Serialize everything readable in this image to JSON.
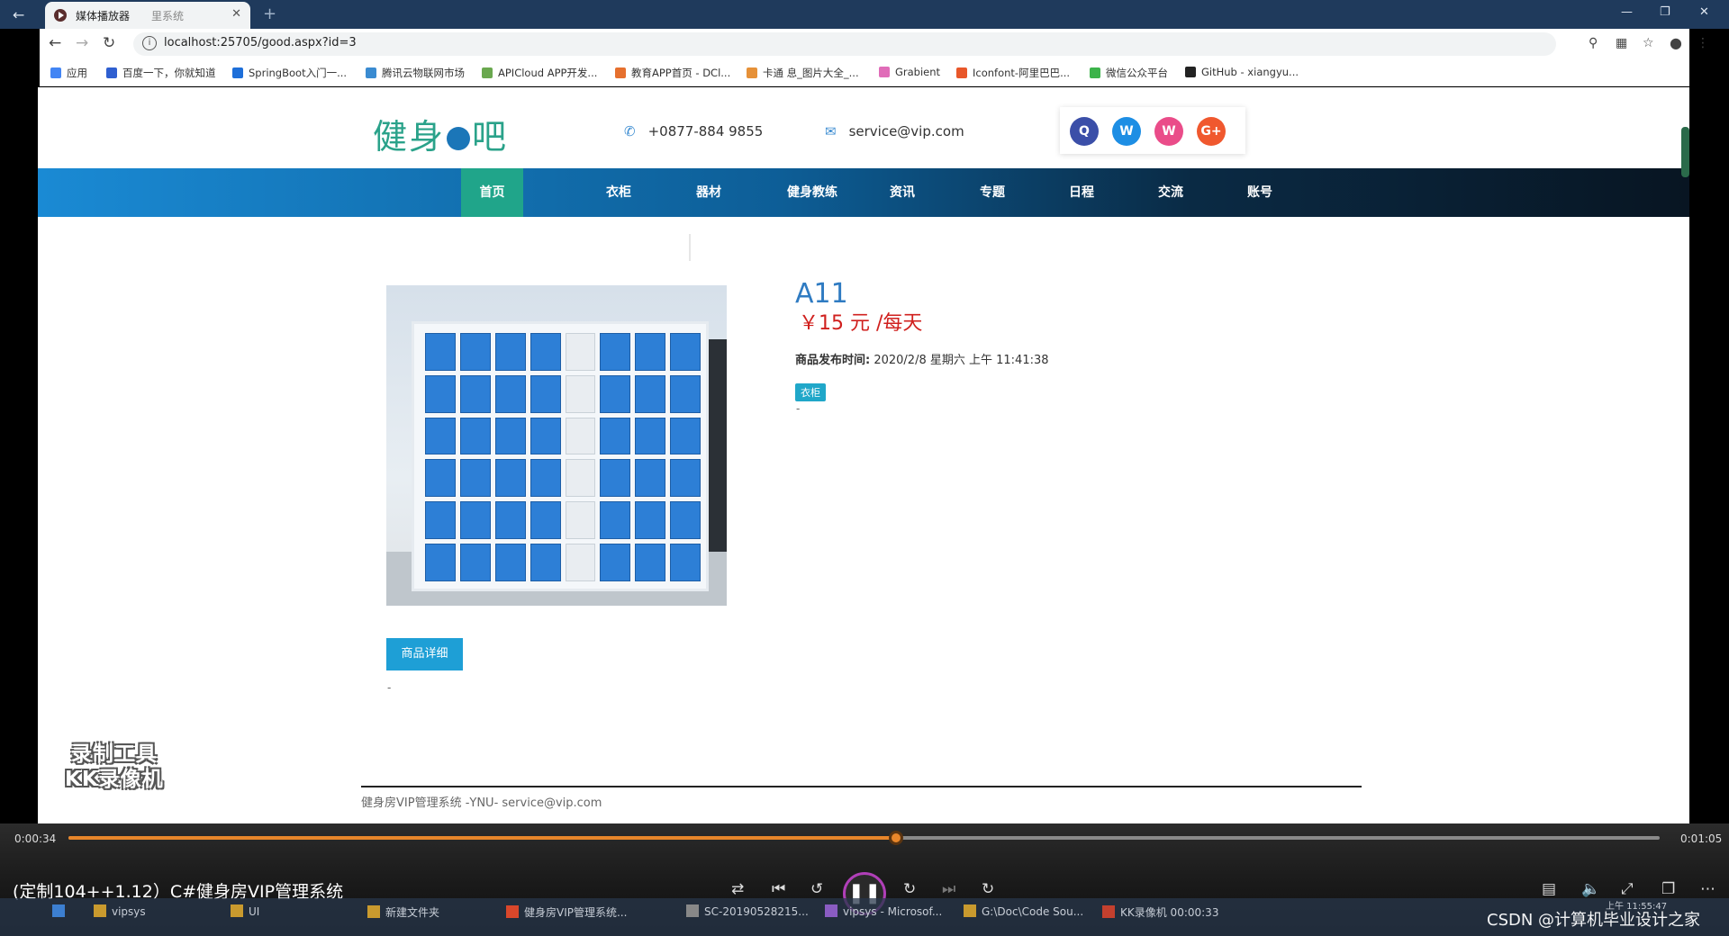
{
  "browser": {
    "tab_title": "媒体播放器",
    "tab_sub": "里系统",
    "url": "localhost:25705/good.aspx?id=3",
    "bookmarks": [
      {
        "label": "应用",
        "color": "#4285f4"
      },
      {
        "label": "百度一下，你就知道",
        "color": "#2f5fd0"
      },
      {
        "label": "SpringBoot入门一...",
        "color": "#1e6fd9"
      },
      {
        "label": "腾讯云物联网市场",
        "color": "#3a8bd1"
      },
      {
        "label": "APICloud APP开发...",
        "color": "#6aa84f"
      },
      {
        "label": "教育APP首页 - DCl...",
        "color": "#e6702e"
      },
      {
        "label": "卡通 息_图片大全_...",
        "color": "#e69138"
      },
      {
        "label": "Grabient",
        "color": "#e06cb8"
      },
      {
        "label": "Iconfont-阿里巴巴...",
        "color": "#e8572a"
      },
      {
        "label": "微信公众平台",
        "color": "#3cb34a"
      },
      {
        "label": "GitHub - xiangyu...",
        "color": "#222222"
      }
    ]
  },
  "site": {
    "logo": "健身",
    "logo_suffix": "吧",
    "phone": "+0877-884 9855",
    "email": "service@vip.com",
    "social": [
      {
        "icon": "qq-icon",
        "glyph": "Q",
        "color": "#3b4fa8"
      },
      {
        "icon": "weibo-icon",
        "glyph": "W",
        "color": "#1d8ee4"
      },
      {
        "icon": "wechat-icon",
        "glyph": "W",
        "color": "#ea4c89"
      },
      {
        "icon": "google-plus-icon",
        "glyph": "G+",
        "color": "#f0582e"
      }
    ],
    "nav": [
      "首页",
      "衣柜",
      "器材",
      "健身教练",
      "资讯",
      "专题",
      "日程",
      "交流",
      "账号"
    ],
    "nav_active": 0
  },
  "product": {
    "title": "A11",
    "price": "￥15 元 /每天",
    "publish_label": "商品发布时间:",
    "publish_time": "2020/2/8 星期六 上午 11:41:38",
    "tag": "衣柜",
    "dash": "-",
    "detail_button": "商品详细",
    "dash2": "-"
  },
  "footer": {
    "text": "健身房VIP管理系统 -YNU- service@vip.com"
  },
  "watermark": {
    "line1": "录制工具",
    "line2": "KK录像机"
  },
  "player": {
    "current_time": "0:00:34",
    "total_time": "0:01:05",
    "progress": 0.52,
    "title": "(定制104++1.12）C#健身房VIP管理系统"
  },
  "taskbar": {
    "items": [
      "vipsys",
      "UI",
      "新建文件夹",
      "健身房VIP管理系统...",
      "SC-20190528215...",
      "vipsys - Microsof...",
      "G:\\Doc\\Code Sou...",
      "KK录像机 00:00:33"
    ],
    "clock": "上午 11:55:47",
    "csdn": "CSDN @计算机毕业设计之家"
  }
}
